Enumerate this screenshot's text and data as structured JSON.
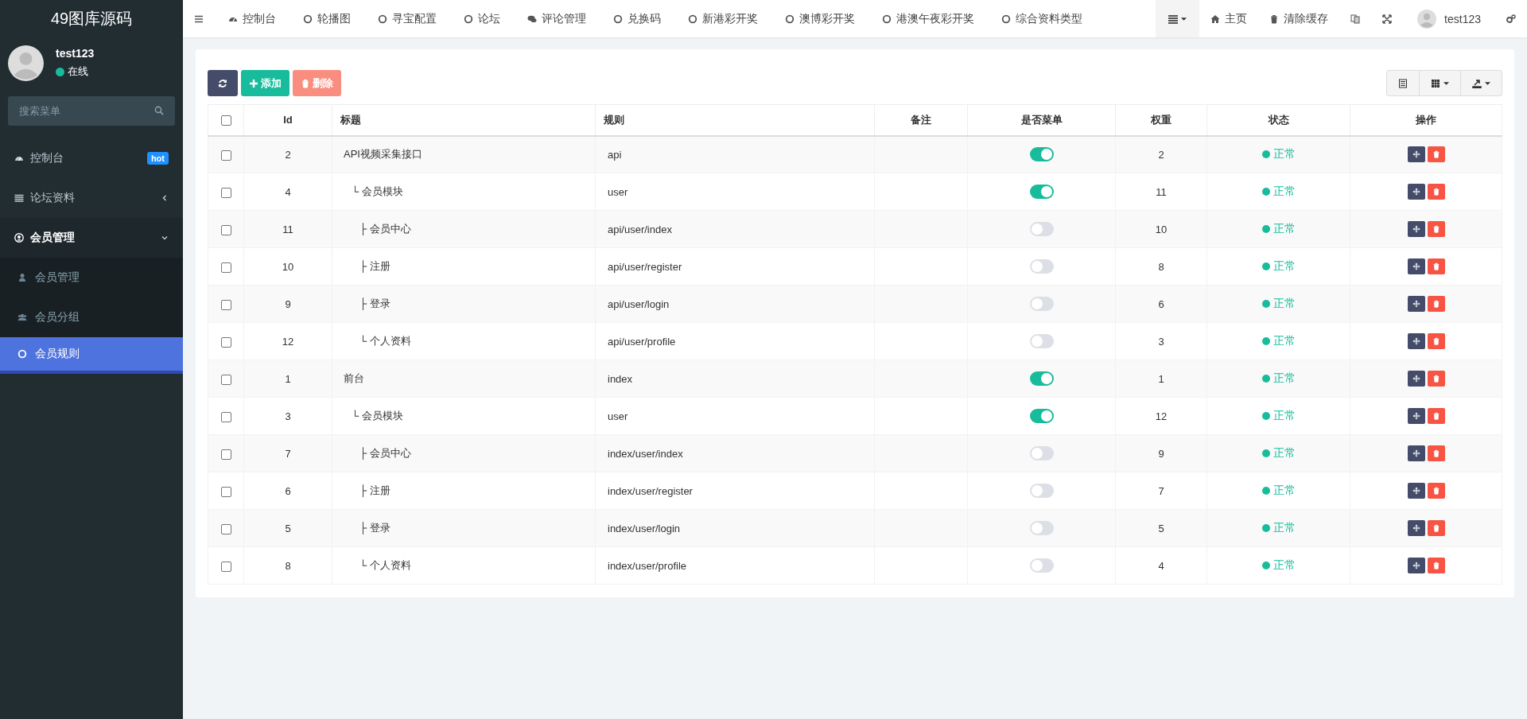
{
  "brand": "49图库源码",
  "user": {
    "name": "test123",
    "status": "在线"
  },
  "search": {
    "placeholder": "搜索菜单"
  },
  "sidebar": {
    "items": [
      {
        "label": "控制台",
        "kind": "gauge",
        "badge": "hot",
        "selected": false
      },
      {
        "label": "论坛资料",
        "kind": "list",
        "expanded": false,
        "selected": false
      },
      {
        "label": "会员管理",
        "kind": "user-circle",
        "expanded": true,
        "selected": false,
        "children": [
          {
            "label": "会员管理",
            "kind": "user",
            "selected": false
          },
          {
            "label": "会员分组",
            "kind": "users",
            "selected": false
          },
          {
            "label": "会员规则",
            "kind": "circle",
            "selected": true
          }
        ]
      }
    ]
  },
  "topnav": [
    {
      "label": "控制台",
      "kind": "gauge"
    },
    {
      "label": "轮播图",
      "kind": "circle"
    },
    {
      "label": "寻宝配置",
      "kind": "circle"
    },
    {
      "label": "论坛",
      "kind": "circle"
    },
    {
      "label": "评论管理",
      "kind": "chat"
    },
    {
      "label": "兑换码",
      "kind": "circle"
    },
    {
      "label": "新港彩开奖",
      "kind": "circle"
    },
    {
      "label": "澳博彩开奖",
      "kind": "circle"
    },
    {
      "label": "港澳午夜彩开奖",
      "kind": "circle"
    },
    {
      "label": "综合资料类型",
      "kind": "circle"
    }
  ],
  "topright": {
    "home": "主页",
    "clear_cache": "清除缓存",
    "user": "test123"
  },
  "toolbar": {
    "add": "添加",
    "delete": "删除"
  },
  "table": {
    "select_all_checked": false,
    "columns": [
      "Id",
      "标题",
      "规则",
      "备注",
      "是否菜单",
      "权重",
      "状态",
      "操作"
    ],
    "rows": [
      {
        "id": "2",
        "title": "API视频采集接口",
        "rule": "api",
        "menu": true,
        "weight": "2",
        "status": "正常",
        "checked": false,
        "children": [
          {
            "id": "4",
            "title": "└ 会员模块",
            "rule": "user",
            "menu": true,
            "weight": "11",
            "status": "正常",
            "checked": false,
            "children": [
              {
                "id": "11",
                "title": "├ 会员中心",
                "rule": "api/user/index",
                "menu": false,
                "weight": "10",
                "status": "正常",
                "checked": false
              },
              {
                "id": "10",
                "title": "├ 注册",
                "rule": "api/user/register",
                "menu": false,
                "weight": "8",
                "status": "正常",
                "checked": false
              },
              {
                "id": "9",
                "title": "├ 登录",
                "rule": "api/user/login",
                "menu": false,
                "weight": "6",
                "status": "正常",
                "checked": false
              },
              {
                "id": "12",
                "title": "└ 个人资料",
                "rule": "api/user/profile",
                "menu": false,
                "weight": "3",
                "status": "正常",
                "checked": false
              }
            ]
          }
        ]
      },
      {
        "id": "1",
        "title": "前台",
        "rule": "index",
        "menu": true,
        "weight": "1",
        "status": "正常",
        "checked": false,
        "children": [
          {
            "id": "3",
            "title": "└ 会员模块",
            "rule": "user",
            "menu": true,
            "weight": "12",
            "status": "正常",
            "checked": false,
            "children": [
              {
                "id": "7",
                "title": "├ 会员中心",
                "rule": "index/user/index",
                "menu": false,
                "weight": "9",
                "status": "正常",
                "checked": false
              },
              {
                "id": "6",
                "title": "├ 注册",
                "rule": "index/user/register",
                "menu": false,
                "weight": "7",
                "status": "正常",
                "checked": false
              },
              {
                "id": "5",
                "title": "├ 登录",
                "rule": "index/user/login",
                "menu": false,
                "weight": "5",
                "status": "正常",
                "checked": false
              },
              {
                "id": "8",
                "title": "└ 个人资料",
                "rule": "index/user/profile",
                "menu": false,
                "weight": "4",
                "status": "正常",
                "checked": false
              }
            ]
          }
        ]
      }
    ]
  }
}
